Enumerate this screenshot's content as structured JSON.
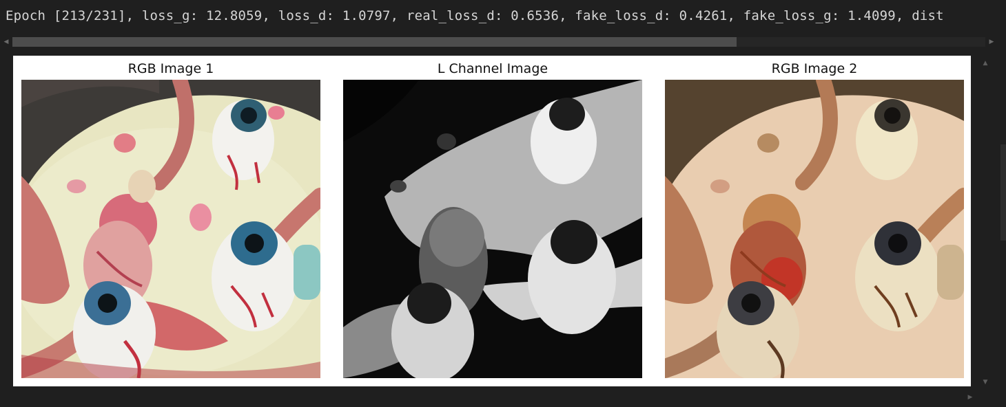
{
  "log": {
    "text": "Epoch [213/231], loss_g: 12.8059, loss_d: 1.0797, real_loss_d: 0.6536, fake_loss_d: 0.4261, fake_loss_g: 1.4099, dist"
  },
  "figure": {
    "panels": [
      {
        "title": "RGB Image 1"
      },
      {
        "title": "L Channel Image"
      },
      {
        "title": "RGB Image 2"
      }
    ]
  },
  "icons": {
    "scroll_left": "chevron-left-icon",
    "scroll_right": "chevron-right-icon",
    "scroll_up": "chevron-up-icon",
    "scroll_down": "chevron-down-icon"
  },
  "colors": {
    "background": "#1f1f1f",
    "log_text": "#d6d6d6",
    "figure_bg": "#ffffff"
  }
}
